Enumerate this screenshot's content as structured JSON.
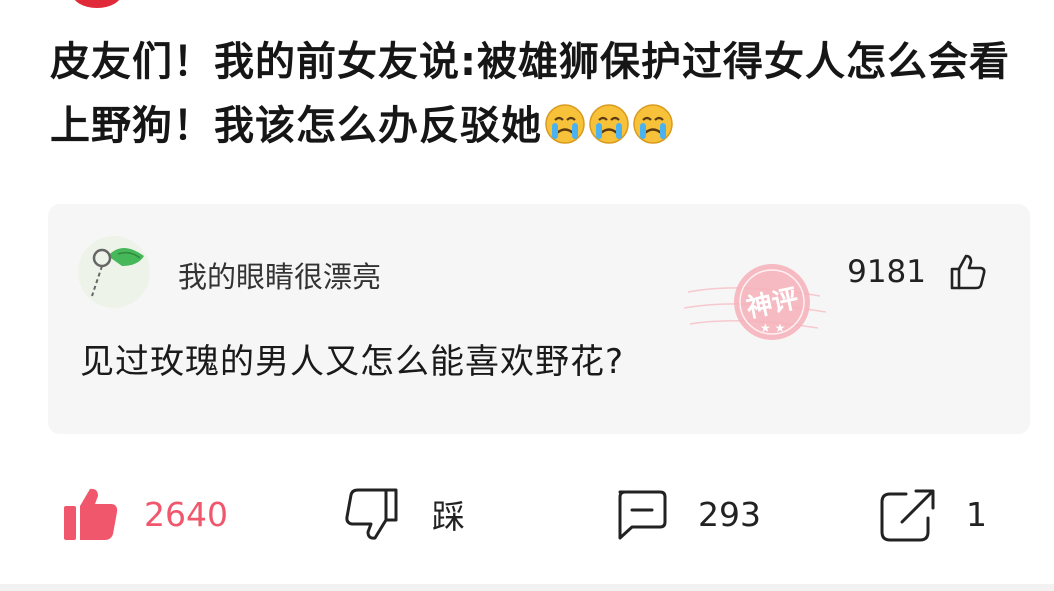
{
  "post": {
    "title": "皮友们！我的前女友说:被雄狮保护过得女人怎么会看上野狗！我该怎么办反驳她",
    "title_emojis": [
      "crying-face-emoji",
      "crying-face-emoji",
      "crying-face-emoji"
    ]
  },
  "comment": {
    "username": "我的眼睛很漂亮",
    "like_count": "9181",
    "text": "见过玫瑰的男人又怎么能喜欢野花?",
    "stamp_label": "神评"
  },
  "actions": {
    "like": {
      "icon": "thumbs-up-icon",
      "count": "2640"
    },
    "dislike": {
      "icon": "thumbs-down-icon",
      "label": "踩"
    },
    "comment": {
      "icon": "comment-icon",
      "count": "293"
    },
    "share": {
      "icon": "share-icon",
      "count": "1"
    }
  },
  "colors": {
    "accent": "#f0566c",
    "card_background": "#f6f6f6",
    "stamp": "#f3a3ad"
  }
}
